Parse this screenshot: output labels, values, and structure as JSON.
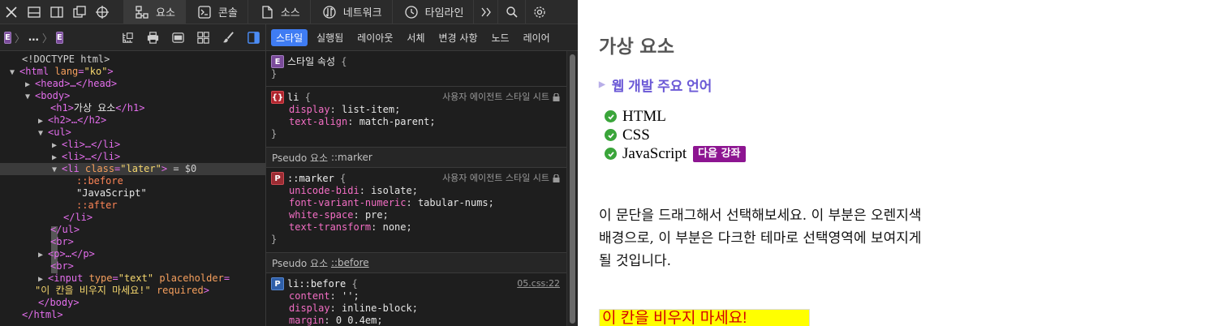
{
  "devtools": {
    "toolbar": {
      "tabs": [
        {
          "label": "요소",
          "icon": "elements-icon",
          "active": true
        },
        {
          "label": "콘솔",
          "icon": "console-icon"
        },
        {
          "label": "소스",
          "icon": "sources-icon"
        },
        {
          "label": "네트워크",
          "icon": "network-icon"
        },
        {
          "label": "타임라인",
          "icon": "timeline-icon"
        }
      ]
    },
    "breadcrumb": {
      "badge": "E",
      "ellipsis": "…"
    },
    "subtabs": [
      "스타일",
      "실행됨",
      "레이아웃",
      "서체",
      "변경 사항",
      "노드",
      "레이어"
    ],
    "dom_tree": {
      "doctype": "<!DOCTYPE html>",
      "html_tag": "html",
      "lang_attr": "lang",
      "lang_val": "\"ko\"",
      "head": "<head>…</head>",
      "body_open": "<body>",
      "h1_open": "<h1>",
      "h1_text": "가상 요소",
      "h1_close": "</h1>",
      "h2": "<h2>…</h2>",
      "ul_open": "<ul>",
      "li_collapsed": "<li>…</li>",
      "li_tag": "li",
      "class_attr": "class",
      "class_val": "\"later\"",
      "selected_suffix": " = $0",
      "before": "::before",
      "js_text": "\"JavaScript\"",
      "after": "::after",
      "li_close": "</li>",
      "ul_close": "</ul>",
      "br": "<br>",
      "p": "<p>…</p>",
      "input_tag": "input",
      "type_attr": "type",
      "type_val": "\"text\"",
      "placeholder_attr": "placeholder",
      "placeholder_val": "\"이 칸을 비우지 마세요!\"",
      "required_attr": "required",
      "body_close": "</body>",
      "html_close": "</html>"
    },
    "styles": {
      "rule1": {
        "badge": "E",
        "selector": "스타일 속성",
        "brace_open": "{",
        "brace_close": "}"
      },
      "rule2": {
        "selector": "li",
        "origin": "사용자 에이전트 스타일 시트",
        "decls": [
          {
            "prop": "display",
            "value": "list-item"
          },
          {
            "prop": "text-align",
            "value": "match-parent"
          }
        ]
      },
      "section_marker": {
        "prefix": "Pseudo 요소",
        "name": "::marker"
      },
      "rule3": {
        "badge": "P",
        "selector": "::marker",
        "origin": "사용자 에이전트 스타일 시트",
        "decls": [
          {
            "prop": "unicode-bidi",
            "value": "isolate"
          },
          {
            "prop": "font-variant-numeric",
            "value": "tabular-nums"
          },
          {
            "prop": "white-space",
            "value": "pre"
          },
          {
            "prop": "text-transform",
            "value": "none"
          }
        ]
      },
      "section_before": {
        "prefix": "Pseudo 요소",
        "name": "::before"
      },
      "rule4": {
        "badge": "P",
        "selector": "li::before",
        "origin": "05.css:22",
        "decls": [
          {
            "prop": "content",
            "value": "''"
          },
          {
            "prop": "display",
            "value": "inline-block"
          },
          {
            "prop": "margin",
            "value": "0 0.4em"
          }
        ]
      }
    }
  },
  "page": {
    "title": "가상 요소",
    "summary": "웹 개발 주요 언어",
    "languages": [
      "HTML",
      "CSS",
      "JavaScript"
    ],
    "later_badge": "다음 강좌",
    "paragraph": "이 문단을 드래그해서 선택해보세요. 이 부분은 오렌지색 배경으로, 이 부분은 다크한 테마로 선택영역에 보여지게 될 것입니다.",
    "input_placeholder": "이 칸을 비우지 마세요!",
    "colors": {
      "accent": "#3f7cf3",
      "summary": "#6b59d6",
      "badge": "#8d1591",
      "input_bg": "#ffff00",
      "placeholder": "#d40000",
      "check": "#3aa53a"
    }
  }
}
